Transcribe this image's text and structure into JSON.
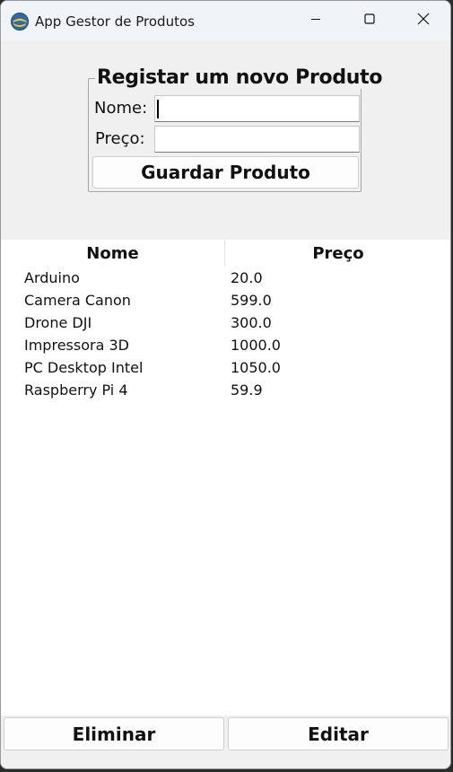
{
  "window": {
    "title": "App Gestor de Produtos"
  },
  "form": {
    "group_title": "Registar um novo Produto",
    "nome_label": "Nome:",
    "preco_label": "Preço:",
    "nome_value": "",
    "preco_value": "",
    "save_label": "Guardar Produto"
  },
  "table": {
    "columns": [
      "Nome",
      "Preço"
    ],
    "rows": [
      {
        "nome": "Arduino",
        "preco": "20.0"
      },
      {
        "nome": "Camera Canon",
        "preco": "599.0"
      },
      {
        "nome": "Drone DJI",
        "preco": "300.0"
      },
      {
        "nome": "Impressora 3D",
        "preco": "1000.0"
      },
      {
        "nome": "PC Desktop Intel",
        "preco": "1050.0"
      },
      {
        "nome": "Raspberry Pi 4",
        "preco": "59.9"
      }
    ]
  },
  "actions": {
    "delete_label": "Eliminar",
    "edit_label": "Editar"
  },
  "icons": {
    "app": "python-feather-icon",
    "minimize": "minimize-icon",
    "maximize": "maximize-icon",
    "close": "close-icon"
  }
}
